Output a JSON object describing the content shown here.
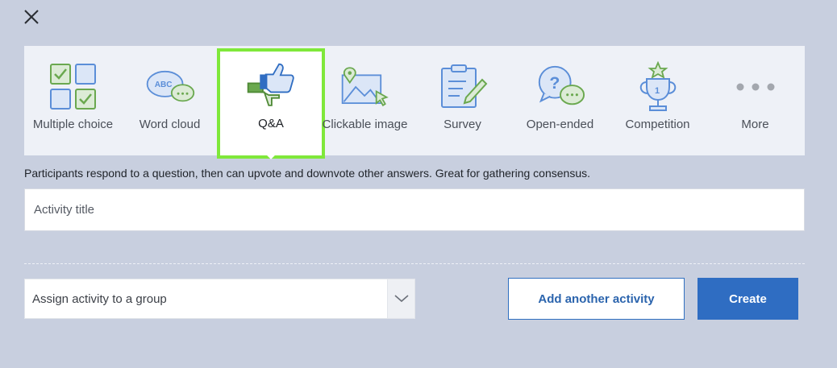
{
  "dialog": {
    "close_icon": "close-icon"
  },
  "activity_types": [
    {
      "label": "Multiple choice",
      "icon": "multiple-choice-icon",
      "selected": false
    },
    {
      "label": "Word cloud",
      "icon": "word-cloud-icon",
      "selected": false
    },
    {
      "label": "Q&A",
      "icon": "thumbs-up-down-icon",
      "selected": true
    },
    {
      "label": "Clickable image",
      "icon": "clickable-image-icon",
      "selected": false
    },
    {
      "label": "Survey",
      "icon": "survey-icon",
      "selected": false
    },
    {
      "label": "Open-ended",
      "icon": "open-ended-icon",
      "selected": false
    },
    {
      "label": "Competition",
      "icon": "trophy-icon",
      "selected": false
    },
    {
      "label": "More",
      "icon": "more-dots-icon",
      "selected": false
    }
  ],
  "description": "Participants respond to a question, then can upvote and downvote other answers. Great for gathering consensus.",
  "title_input": {
    "placeholder": "Activity title",
    "value": ""
  },
  "group_select": {
    "value": "Assign activity to a group"
  },
  "buttons": {
    "add_another": "Add another activity",
    "create": "Create"
  },
  "colors": {
    "background": "#c8cfdf",
    "panel": "#eef1f7",
    "selected_border": "#7fe83a",
    "primary": "#2f6dc2",
    "icon_blue": "#5b8ed8",
    "icon_green": "#6aa84f"
  }
}
